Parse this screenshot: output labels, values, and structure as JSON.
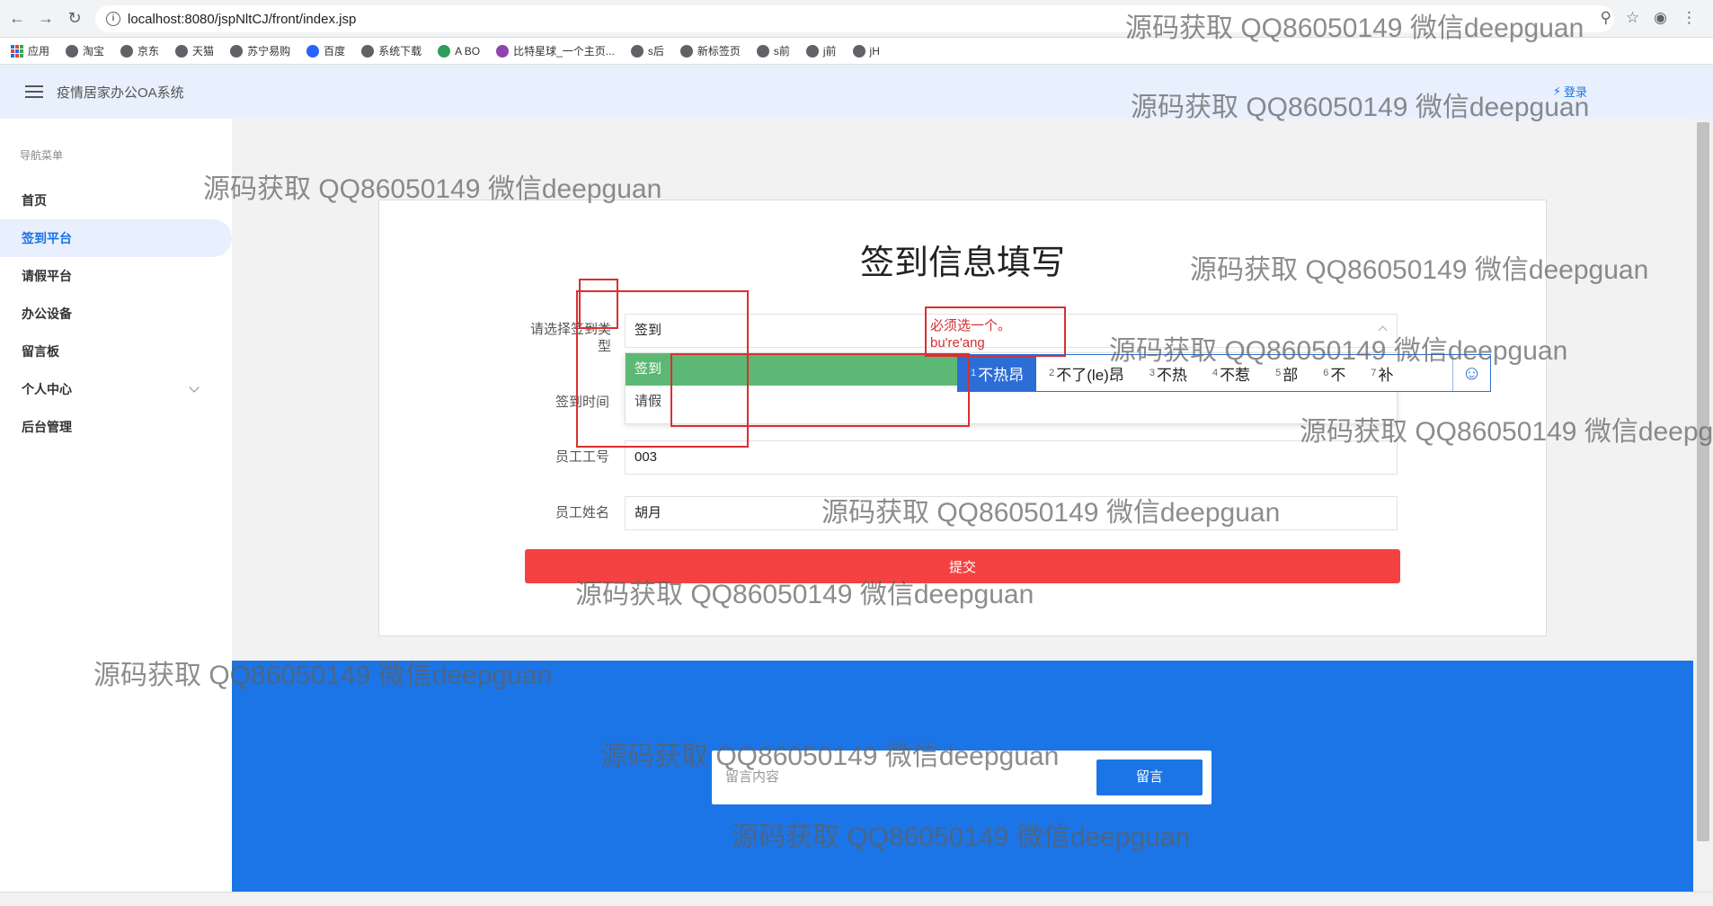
{
  "browser": {
    "url": "localhost:8080/jspNltCJ/front/index.jsp",
    "bookmarks": [
      "应用",
      "淘宝",
      "京东",
      "天猫",
      "苏宁易购",
      "百度",
      "系统下载",
      "A BO",
      "比特星球_一个主页...",
      "s后",
      "新标签页",
      "s前",
      "j前",
      "jH"
    ]
  },
  "header": {
    "title": "疫情居家办公OA系统",
    "login": "登录"
  },
  "sidebar": {
    "heading": "导航菜单",
    "items": [
      {
        "label": "首页"
      },
      {
        "label": "签到平台"
      },
      {
        "label": "请假平台"
      },
      {
        "label": "办公设备"
      },
      {
        "label": "留言板"
      },
      {
        "label": "个人中心"
      },
      {
        "label": "后台管理"
      }
    ]
  },
  "form": {
    "title": "签到信息填写",
    "type_label": "请选择签到类型",
    "type_value": "签到",
    "type_options": [
      "签到",
      "请假"
    ],
    "time_label": "签到时间",
    "emp_id_label": "员工工号",
    "emp_id_value": "003",
    "emp_name_label": "员工姓名",
    "emp_name_value": "胡月",
    "submit": "提交"
  },
  "ime": {
    "composition": "必须选一个。bu're'ang",
    "candidates": [
      {
        "index": "1",
        "text": "不热昂"
      },
      {
        "index": "2",
        "text": "不了(le)昂"
      },
      {
        "index": "3",
        "text": "不热"
      },
      {
        "index": "4",
        "text": "不惹"
      },
      {
        "index": "5",
        "text": "部"
      },
      {
        "index": "6",
        "text": "不"
      },
      {
        "index": "7",
        "text": "补"
      }
    ],
    "emoji": "☺"
  },
  "footer": {
    "message_placeholder": "留言内容",
    "message_button": "留言"
  },
  "watermark": "源码获取 QQ86050149 微信deepguan"
}
